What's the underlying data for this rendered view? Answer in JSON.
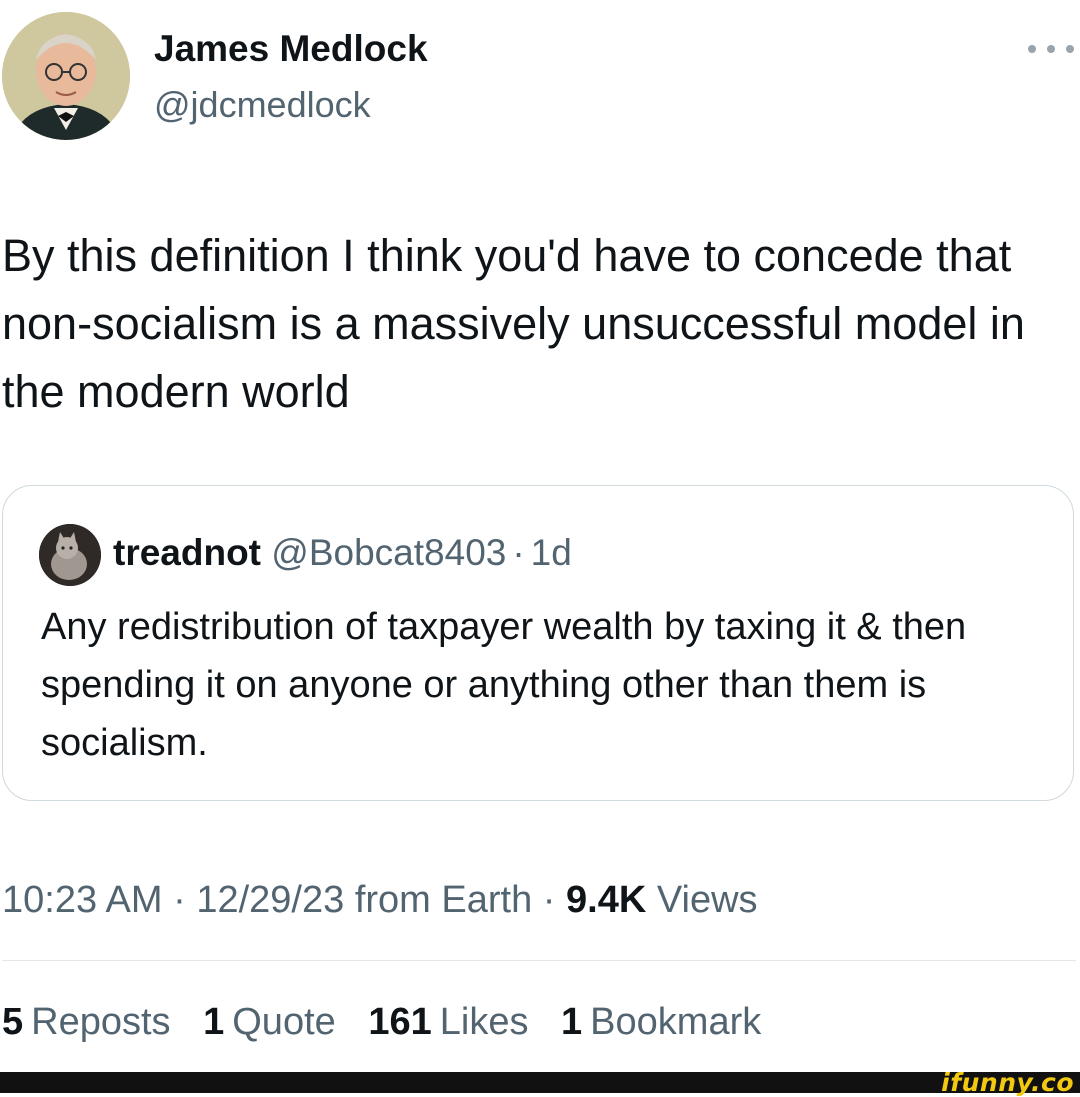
{
  "author": {
    "name": "James Medlock",
    "handle": "@jdcmedlock"
  },
  "tweet": {
    "text": "By this definition I think you'd have to concede that non-socialism is a massively unsuccessful model in the modern world"
  },
  "quoted": {
    "name": "treadnot",
    "handle": "@Bobcat8403",
    "separator": "·",
    "time": "1d",
    "text": "Any redistribution of taxpayer wealth by taxing it & then spending it on anyone or anything other than them is socialism."
  },
  "meta": {
    "time": "10:23 AM",
    "separator": "·",
    "date": "12/29/23",
    "source": "from Earth",
    "views_count": "9.4K",
    "views_label": "Views"
  },
  "stats": [
    {
      "count": "5",
      "label": "Reposts"
    },
    {
      "count": "1",
      "label": "Quote"
    },
    {
      "count": "161",
      "label": "Likes"
    },
    {
      "count": "1",
      "label": "Bookmark"
    }
  ],
  "watermark": "ifunny.co",
  "colors": {
    "text": "#0f1419",
    "secondary": "#536471",
    "border": "#cfd9de"
  }
}
